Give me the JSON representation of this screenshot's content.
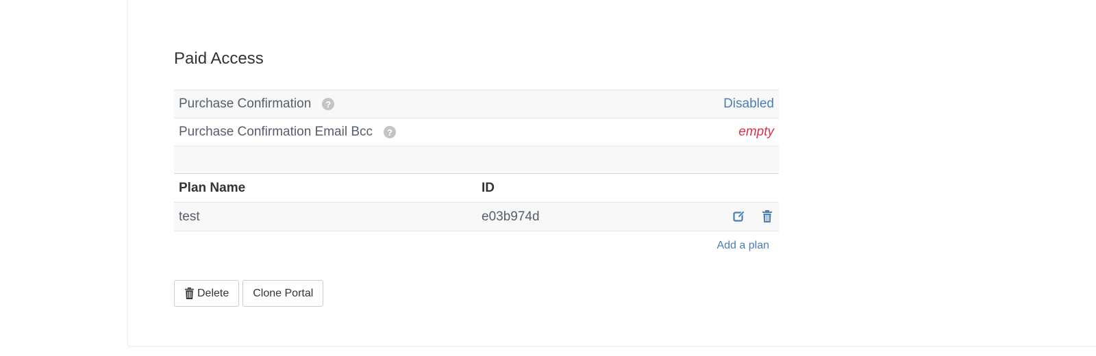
{
  "section": {
    "title": "Paid Access"
  },
  "settings": [
    {
      "label": "Purchase Confirmation",
      "help_icon": "?",
      "value": "Disabled"
    },
    {
      "label": "Purchase Confirmation Email Bcc",
      "help_icon": "?",
      "value": "empty"
    }
  ],
  "plans_table": {
    "headers": {
      "name": "Plan Name",
      "id": "ID"
    },
    "rows": [
      {
        "name": "test",
        "id": "e03b974d"
      }
    ],
    "add_plan_label": "Add a plan",
    "icons": {
      "edit": "edit-icon",
      "delete": "trash-icon"
    }
  },
  "buttons": {
    "delete_label": "Delete",
    "clone_label": "Clone Portal"
  },
  "colors": {
    "link": "#4a7fb5",
    "empty_value": "#d9304c",
    "stripe": "#f8f8f8"
  }
}
